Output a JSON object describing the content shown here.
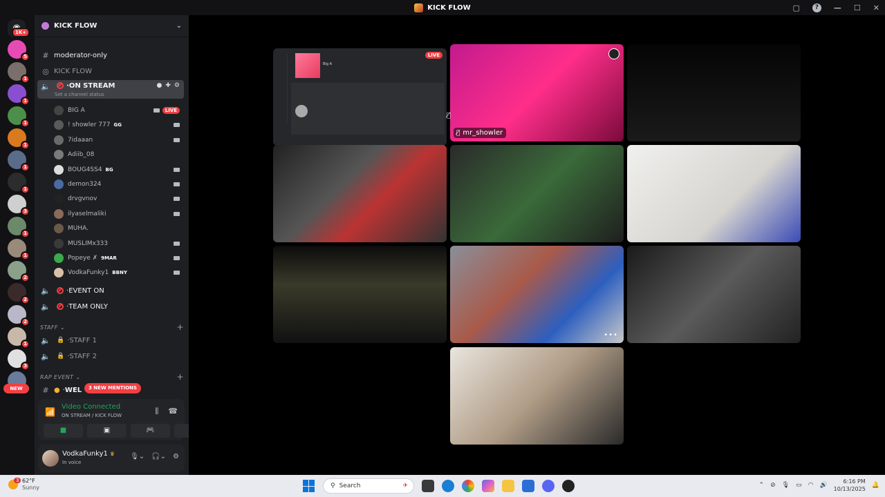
{
  "window": {
    "title": "KICK FLOW"
  },
  "rail": {
    "home_badge": "1K+",
    "new_label": "NEW",
    "servers": [
      {
        "badge": "5",
        "color": "#e64bb5"
      },
      {
        "badge": "1",
        "color": "#7a6f6a"
      },
      {
        "badge": "1",
        "color": "#8a4fd1"
      },
      {
        "badge": "1",
        "color": "#4c8f4a"
      },
      {
        "badge": "1",
        "color": "#d97a1e"
      },
      {
        "badge": "1",
        "color": "#5b6b8a"
      },
      {
        "badge": "1",
        "color": "#2c2c2c"
      },
      {
        "badge": "3",
        "color": "#cfcfcf"
      },
      {
        "badge": "1",
        "color": "#6a8a6a"
      },
      {
        "badge": "1",
        "color": "#9a8a7a"
      },
      {
        "badge": "2",
        "color": "#8aa08a"
      },
      {
        "badge": "2",
        "color": "#3a2a2a"
      },
      {
        "badge": "2",
        "color": "#b8b8c8"
      },
      {
        "badge": "1",
        "color": "#c8b8a8"
      },
      {
        "badge": "3",
        "color": "#e0e0e0"
      },
      {
        "badge": "",
        "color": "#6a7a9a"
      }
    ]
  },
  "sidebar": {
    "server_name": "KICK FLOW",
    "channels": {
      "moderator_only": "moderator-only",
      "kick_flow": "KICK FLOW",
      "on_stream": "ON STREAM",
      "on_stream_status": "Set a channel status",
      "event_on": "EVENT ON",
      "team_only": "TEAM ONLY",
      "staff_1": "STAFF 1",
      "staff_2": "STAFF 2",
      "wel": "WEL"
    },
    "categories": {
      "staff": "STAFF",
      "rap_event": "RAP EVENT"
    },
    "mentions": "3 NEW MENTIONS",
    "members": [
      {
        "name": "BIG A",
        "tag": "",
        "live": "LIVE",
        "color": "#444"
      },
      {
        "name": "! showler 777",
        "tag": "GG",
        "live": "",
        "color": "#5a5a5a"
      },
      {
        "name": "7idaaan",
        "tag": "",
        "live": "",
        "color": "#6a6a6a"
      },
      {
        "name": "Adiib_08",
        "tag": "",
        "live": "",
        "color": "#7a7a7a"
      },
      {
        "name": "BOUG4SS4",
        "tag": "BG",
        "live": "",
        "color": "#ddd"
      },
      {
        "name": "demon324",
        "tag": "",
        "live": "",
        "color": "#4a6aa0"
      },
      {
        "name": "drvgvnov",
        "tag": "",
        "live": "",
        "color": "#222"
      },
      {
        "name": "ilyaselmaliki",
        "tag": "",
        "live": "",
        "color": "#8a6a5a"
      },
      {
        "name": "MUHA.",
        "tag": "",
        "live": "",
        "color": "#6a5a4a"
      },
      {
        "name": "MUSLIMx333",
        "tag": "",
        "live": "",
        "color": "#3a3a3a"
      },
      {
        "name": "Popeye ✗",
        "tag": "9MAR",
        "live": "",
        "color": "#3ca94a"
      },
      {
        "name": "VodkaFunky1",
        "tag": "BBNY",
        "live": "",
        "color": "#d8c0a8"
      }
    ]
  },
  "voice": {
    "status": "Video Connected",
    "location": "ON STREAM / KICK FLOW"
  },
  "user": {
    "name": "VodkaFunky1",
    "status": "In voice"
  },
  "stage": {
    "stream_live": "LIVE",
    "stream_title": "Big A",
    "tiles": [
      {
        "name": "mr_showler",
        "bg": "linear-gradient(135deg,#c21a8e,#ff2e8a 50%,#7a0b3b)"
      },
      {
        "name": "",
        "bg": "linear-gradient(180deg,#050505,#1a1a1a)"
      },
      {
        "name": "",
        "bg": "linear-gradient(135deg,#222,#555 40%,#b33 60%,#333)"
      },
      {
        "name": "",
        "bg": "linear-gradient(135deg,#2a2a2a,#3a6a3a 50%,#1f1f1f)"
      },
      {
        "name": "",
        "bg": "linear-gradient(135deg,#f0f0ee,#d6d4cf 60%,#3b4cb5)"
      },
      {
        "name": "",
        "bg": "linear-gradient(180deg,#0c0c0c,#3a3a2a 40%,#111)"
      },
      {
        "name": "",
        "bg": "linear-gradient(135deg,#8a8f9a,#a95a4a 40%,#2d5fbf 70%,#c8c8c8)"
      },
      {
        "name": "",
        "bg": "linear-gradient(135deg,#1a1a1a,#5a5a5a 50%,#222)"
      },
      {
        "name": "",
        "bg": "linear-gradient(135deg,#e9e5de,#b09c86 50%,#2a2a2a)"
      }
    ]
  },
  "taskbar": {
    "temp": "62°F",
    "condition": "Sunny",
    "weather_badge": "3",
    "search_placeholder": "Search",
    "time": "6:16 PM",
    "date": "10/13/2025"
  }
}
